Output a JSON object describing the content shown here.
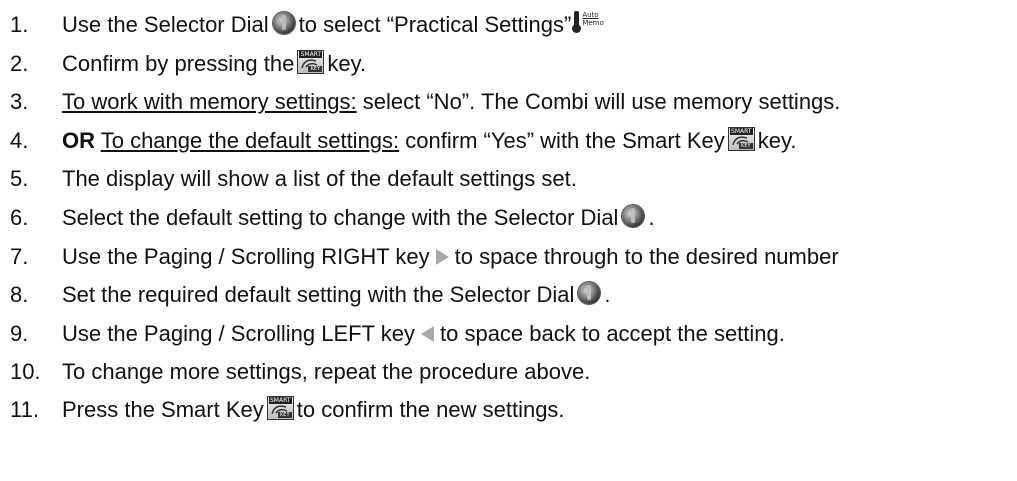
{
  "steps": [
    {
      "n": "1.",
      "a": "Use the Selector Dial",
      "b": "to select “Practical Settings”"
    },
    {
      "n": "2.",
      "a": "Confirm by pressing the",
      "b": "key."
    },
    {
      "n": "3.",
      "u": "To work with memory settings:",
      "b": "select “No”. The Combi will use memory settings."
    },
    {
      "n": "4.",
      "bold": "OR",
      "u": "To change the default settings:",
      "a": "confirm “Yes” with the Smart Key",
      "b": "key."
    },
    {
      "n": "5.",
      "a": "The display will show a list of the default settings set."
    },
    {
      "n": "6.",
      "a": "Select the default setting to change with the Selector Dial",
      "b": "."
    },
    {
      "n": "7.",
      "a": "Use the Paging / Scrolling RIGHT key",
      "b": "to space through to the desired number"
    },
    {
      "n": "8.",
      "a": "Set the required default setting with the Selector Dial",
      "b": "."
    },
    {
      "n": "9.",
      "a": "Use the Paging / Scrolling LEFT key",
      "b": "to space back to accept the setting."
    },
    {
      "n": "10.",
      "a": "To change more settings, repeat the procedure above."
    },
    {
      "n": "11.",
      "a": "Press the Smart Key",
      "b": "to confirm the new settings."
    }
  ],
  "icons": {
    "smart_key_top": "SMART",
    "smart_key_bottom": "KEY",
    "auto_label": "Auto",
    "memo_label": "Memo",
    "dial": "selector-dial-icon",
    "smart_key": "smart-key-icon",
    "auto_memo": "auto-memo-icon",
    "right": "arrow-right-icon",
    "left": "arrow-left-icon"
  }
}
